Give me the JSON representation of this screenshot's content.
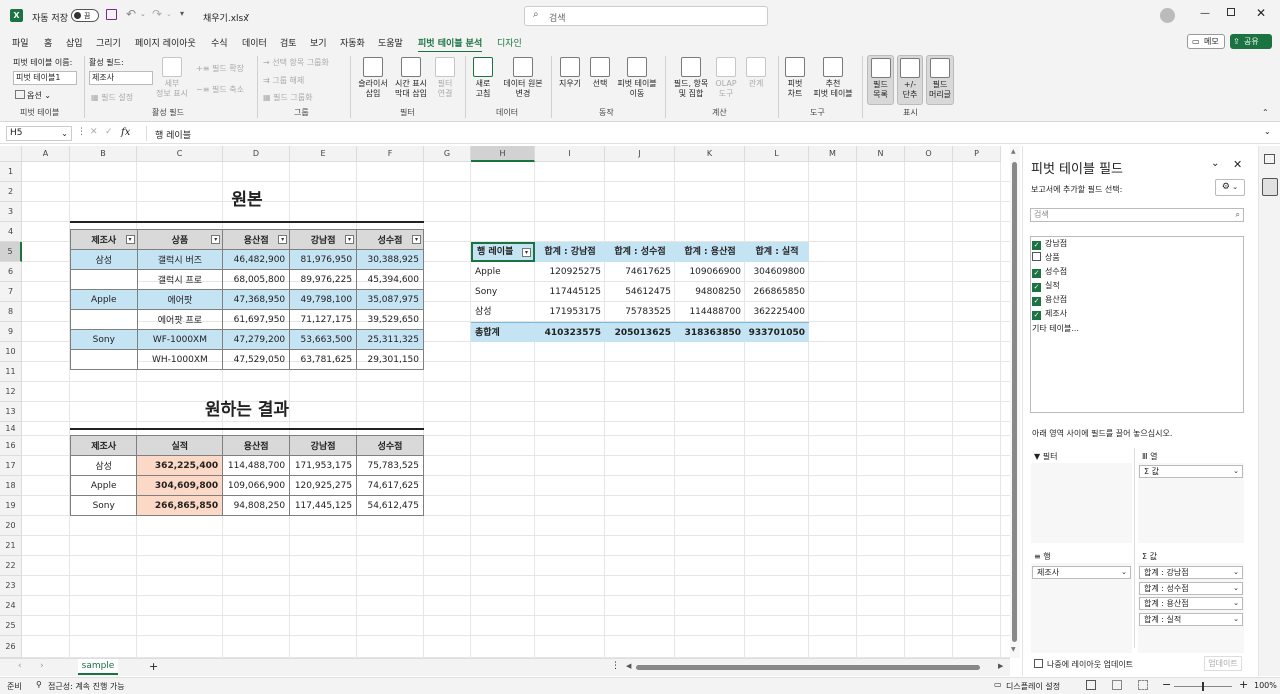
{
  "titlebar": {
    "autosave_label": "자동 저장",
    "autosave_state": "끔",
    "filename": "채우기.xlsx",
    "search_placeholder": "검색"
  },
  "menu": [
    "파일",
    "홈",
    "삽입",
    "그리기",
    "페이지 레이아웃",
    "수식",
    "데이터",
    "검토",
    "보기",
    "자동화",
    "도움말",
    "피벗 테이블 분석",
    "디자인"
  ],
  "menu_right": {
    "memo": "메모",
    "share": "공유"
  },
  "ribbon": {
    "pt_name_label": "피벗 테이블 이름:",
    "pt_name_value": "피벗 테이블1",
    "active_field_label": "활성 필드:",
    "active_field_value": "제조사",
    "options": "옵션",
    "field_settings": "필드 설정",
    "drill_down": "세부\n정보 표시",
    "expand_field": "필드 확장",
    "collapse_field": "필드 축소",
    "group_selection": "선택 항목 그룹화",
    "ungroup": "그룹 해제",
    "group_field": "필드 그룹화",
    "slicer": "슬라이서\n삽입",
    "timeline": "시간 표시\n막대 삽입",
    "filter_conn": "필터\n연결",
    "refresh": "새로\n고침",
    "change_source": "데이터 원본\n변경",
    "clear": "지우기",
    "select": "선택",
    "move_pt": "피벗 테이블\n이동",
    "fields_items": "필드, 항목\n및 집합",
    "olap": "OLAP\n도구",
    "relations": "관계",
    "pivot_chart": "피벗\n차트",
    "recommended": "추천\n피벗 테이블",
    "field_list": "필드\n목록",
    "plus_minus": "+/-\n단추",
    "field_headers": "필드\n머리글",
    "groups": [
      "피벗 테이블",
      "활성 필드",
      "그룹",
      "필터",
      "데이터",
      "동작",
      "계산",
      "도구",
      "표시"
    ]
  },
  "formula_bar": {
    "name_box": "H5",
    "fx": "fx",
    "content": "행 레이블"
  },
  "columns": [
    "A",
    "B",
    "C",
    "D",
    "E",
    "F",
    "G",
    "H",
    "I",
    "J",
    "K",
    "L",
    "M",
    "N",
    "O",
    "P"
  ],
  "rows": [
    "1",
    "2",
    "3",
    "4",
    "5",
    "6",
    "7",
    "8",
    "9",
    "10",
    "11",
    "12",
    "13",
    "14",
    "16",
    "17",
    "18",
    "19",
    "20",
    "21",
    "22",
    "23",
    "24",
    "25",
    "26"
  ],
  "source_table": {
    "title": "원본",
    "headers": [
      "제조사",
      "상품",
      "용산점",
      "강남점",
      "성수점"
    ],
    "rows": [
      [
        "삼성",
        "갤럭시 버즈",
        "46,482,900",
        "81,976,950",
        "30,388,925"
      ],
      [
        "",
        "갤럭시 프로",
        "68,005,800",
        "89,976,225",
        "45,394,600"
      ],
      [
        "Apple",
        "에어팟",
        "47,368,950",
        "49,798,100",
        "35,087,975"
      ],
      [
        "",
        "에어팟 프로",
        "61,697,950",
        "71,127,175",
        "39,529,650"
      ],
      [
        "Sony",
        "WF-1000XM",
        "47,279,200",
        "53,663,500",
        "25,311,325"
      ],
      [
        "",
        "WH-1000XM",
        "47,529,050",
        "63,781,625",
        "29,301,150"
      ]
    ]
  },
  "result_table": {
    "title": "원하는 결과",
    "headers": [
      "제조사",
      "실적",
      "용산점",
      "강남점",
      "성수점"
    ],
    "rows": [
      [
        "삼성",
        "362,225,400",
        "114,488,700",
        "171,953,175",
        "75,783,525"
      ],
      [
        "Apple",
        "304,609,800",
        "109,066,900",
        "120,925,275",
        "74,617,625"
      ],
      [
        "Sony",
        "266,865,850",
        "94,808,250",
        "117,445,125",
        "54,612,475"
      ]
    ]
  },
  "pivot": {
    "headers": [
      "행 레이블",
      "합계 : 강남점",
      "합계 : 성수점",
      "합계 : 용산점",
      "합계 : 실적"
    ],
    "rows": [
      [
        "Apple",
        "120925275",
        "74617625",
        "109066900",
        "304609800"
      ],
      [
        "Sony",
        "117445125",
        "54612475",
        "94808250",
        "266865850"
      ],
      [
        "삼성",
        "171953175",
        "75783525",
        "114488700",
        "362225400"
      ]
    ],
    "total": [
      "총합계",
      "410323575",
      "205013625",
      "318363850",
      "933701050"
    ]
  },
  "pane": {
    "title": "피벗 테이블 필드",
    "subtitle": "보고서에 추가할 필드 선택:",
    "search_placeholder": "검색",
    "fields": [
      {
        "name": "강남점",
        "checked": true
      },
      {
        "name": "상품",
        "checked": false
      },
      {
        "name": "성수점",
        "checked": true
      },
      {
        "name": "실적",
        "checked": true
      },
      {
        "name": "용산점",
        "checked": true
      },
      {
        "name": "제조사",
        "checked": true
      }
    ],
    "more_tables": "기타 테이블...",
    "drag_hint": "아래 영역 사이에 필드를 끌어 놓으십시오.",
    "filter_label": "필터",
    "columns_label": "열",
    "columns_items": [
      "Σ 값"
    ],
    "rows_label": "행",
    "rows_items": [
      "제조사"
    ],
    "values_label": "Σ 값",
    "values_items": [
      "합계 : 강남점",
      "합계 : 성수점",
      "합계 : 용산점",
      "합계 : 실적"
    ],
    "defer_label": "나중에 레이아웃 업데이트",
    "update_button": "업데이트"
  },
  "sheet_tab": "sample",
  "status": {
    "ready": "준비",
    "accessibility": "접근성: 계속 진행 가능",
    "display_settings": "디스플레이 설정",
    "zoom": "100%"
  },
  "colors": {
    "excel_green": "#1a7340",
    "blue_fill": "#c4e3f3",
    "peach_fill": "#fbd9c6"
  }
}
